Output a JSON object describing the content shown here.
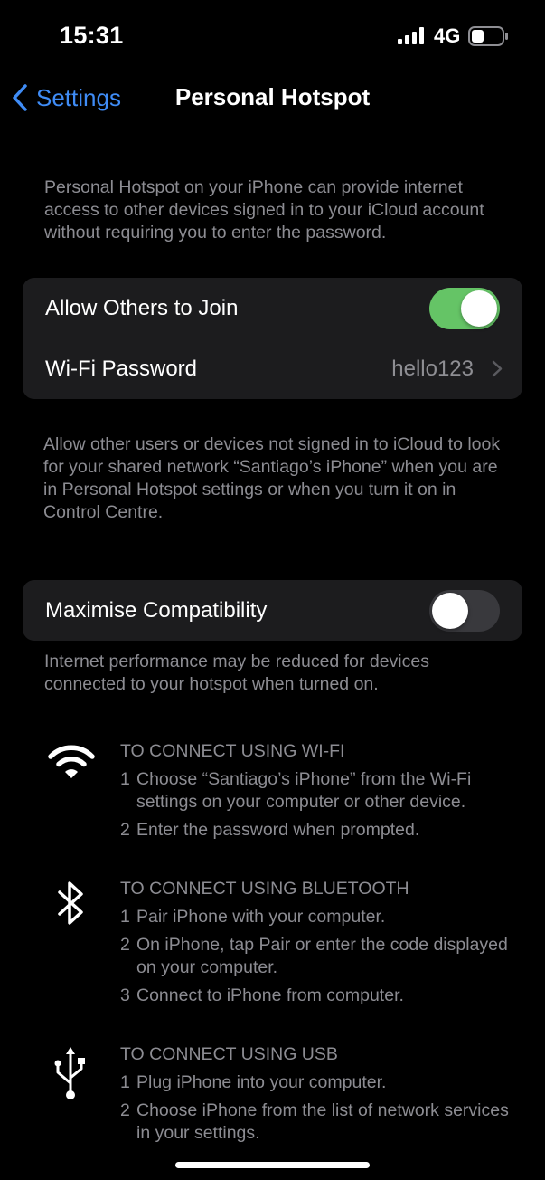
{
  "status_bar": {
    "time": "15:31",
    "network": "4G"
  },
  "nav": {
    "back_label": "Settings",
    "title": "Personal Hotspot"
  },
  "intro_text": "Personal Hotspot on your iPhone can provide internet access to other devices signed in to your iCloud account without requiring you to enter the password.",
  "hotspot_group": {
    "allow_others": {
      "label": "Allow Others to Join",
      "enabled": true
    },
    "wifi_password": {
      "label": "Wi-Fi Password",
      "value": "hello123"
    }
  },
  "allow_footer": "Allow other users or devices not signed in to iCloud to look for your shared network “Santiago’s iPhone” when you are in Personal Hotspot settings or when you turn it on in Control Centre.",
  "compat_group": {
    "maximise": {
      "label": "Maximise Compatibility",
      "enabled": false
    }
  },
  "compat_footer": "Internet performance may be reduced for devices connected to your hotspot when turned on.",
  "instructions": {
    "wifi": {
      "title": "TO CONNECT USING WI-FI",
      "steps": [
        {
          "num": "1",
          "text": "Choose “Santiago’s iPhone” from the Wi-Fi settings on your computer or other device."
        },
        {
          "num": "2",
          "text": "Enter the password when prompted."
        }
      ]
    },
    "bluetooth": {
      "title": "TO CONNECT USING BLUETOOTH",
      "steps": [
        {
          "num": "1",
          "text": "Pair iPhone with your computer."
        },
        {
          "num": "2",
          "text": "On iPhone, tap Pair or enter the code displayed on your computer."
        },
        {
          "num": "3",
          "text": "Connect to iPhone from computer."
        }
      ]
    },
    "usb": {
      "title": "TO CONNECT USING USB",
      "steps": [
        {
          "num": "1",
          "text": "Plug iPhone into your computer."
        },
        {
          "num": "2",
          "text": "Choose iPhone from the list of network services in your settings."
        }
      ]
    }
  },
  "icons": {
    "signal": "cellular-signal-icon",
    "battery": "battery-icon",
    "back": "chevron-left-icon",
    "disclosure": "chevron-right-icon",
    "wifi": "wifi-icon",
    "bluetooth": "bluetooth-icon",
    "usb": "usb-icon"
  },
  "colors": {
    "background": "#000000",
    "group_background": "#1c1c1e",
    "accent_blue": "#3f8cf6",
    "toggle_on": "#65c466",
    "toggle_off": "#39393d",
    "secondary_text": "#8c8c92"
  }
}
